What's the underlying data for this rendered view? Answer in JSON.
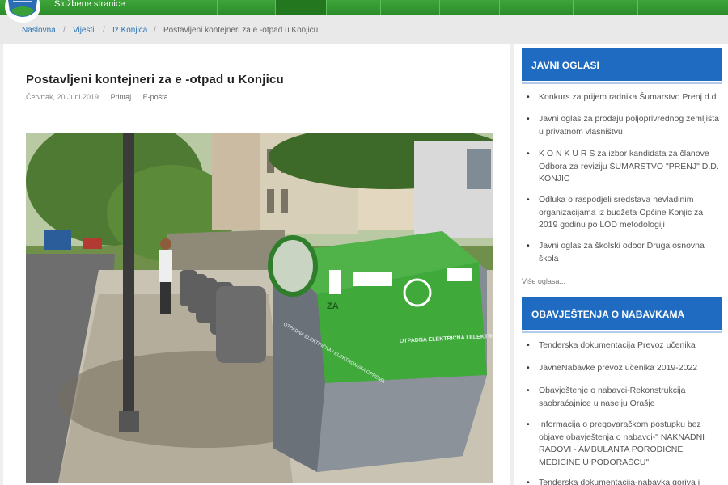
{
  "header": {
    "site_label": "Službene stranice",
    "brand_color": "#2b8c2a"
  },
  "breadcrumb": {
    "home": "Naslovna",
    "news": "Vijesti",
    "section": "Iz Konjica",
    "current": "Postavljeni kontejneri za e -otpad u Konjicu"
  },
  "article": {
    "title": "Postavljeni kontejneri za e -otpad u Konjicu",
    "date": "Četvrtak, 20 Juni 2019",
    "print_label": "Printaj",
    "email_label": "E-pošta",
    "photo": {
      "container_top_text": "OTPADNA ELEKTRIČNA I ELEKTRONSKA OPREMA",
      "container_side_text": "OTPADNA ELEKTRIČNA I ELEKTRONSKA OPREMA",
      "za_label": "ZA"
    }
  },
  "sidebar": {
    "ads_title": "JAVNI OGLASI",
    "ads": [
      "Konkurs za prijem radnika Šumarstvo Prenj d.d",
      "Javni oglas za prodaju poljoprivrednog zemljišta u privatnom vlasništvu",
      "K O N K U R S za izbor kandidata za članove Odbora za reviziju ŠUMARSTVO \"PRENJ\" D.D. KONJIC",
      "Odluka o raspodjeli sredstava nevladinim organizacijama iz budžeta Općine Konjic za 2019 godinu po LOD metodologiji",
      "Javni oglas za školski odbor Druga osnovna škola"
    ],
    "more_label": "Više oglasa...",
    "proc_title": "OBAVJEŠTENJA O NABAVKAMA",
    "procurement": [
      "Tenderska dokumentacija Prevoz učenika",
      "JavneNabavke prevoz učenika 2019-2022",
      "Obavještenje o nabavci-Rekonstrukcija saobraćajnice u naselju Orašje",
      "Informacija o pregovaračkom postupku bez objave obavještenja o nabavci-\" NAKNADNI RADOVI - AMBULANTA PORODIČNE MEDICINE U PODORAŠCU\"",
      "Tenderska dokumentacija-nabavka goriva i"
    ],
    "accent_color": "#1f6bc1"
  }
}
